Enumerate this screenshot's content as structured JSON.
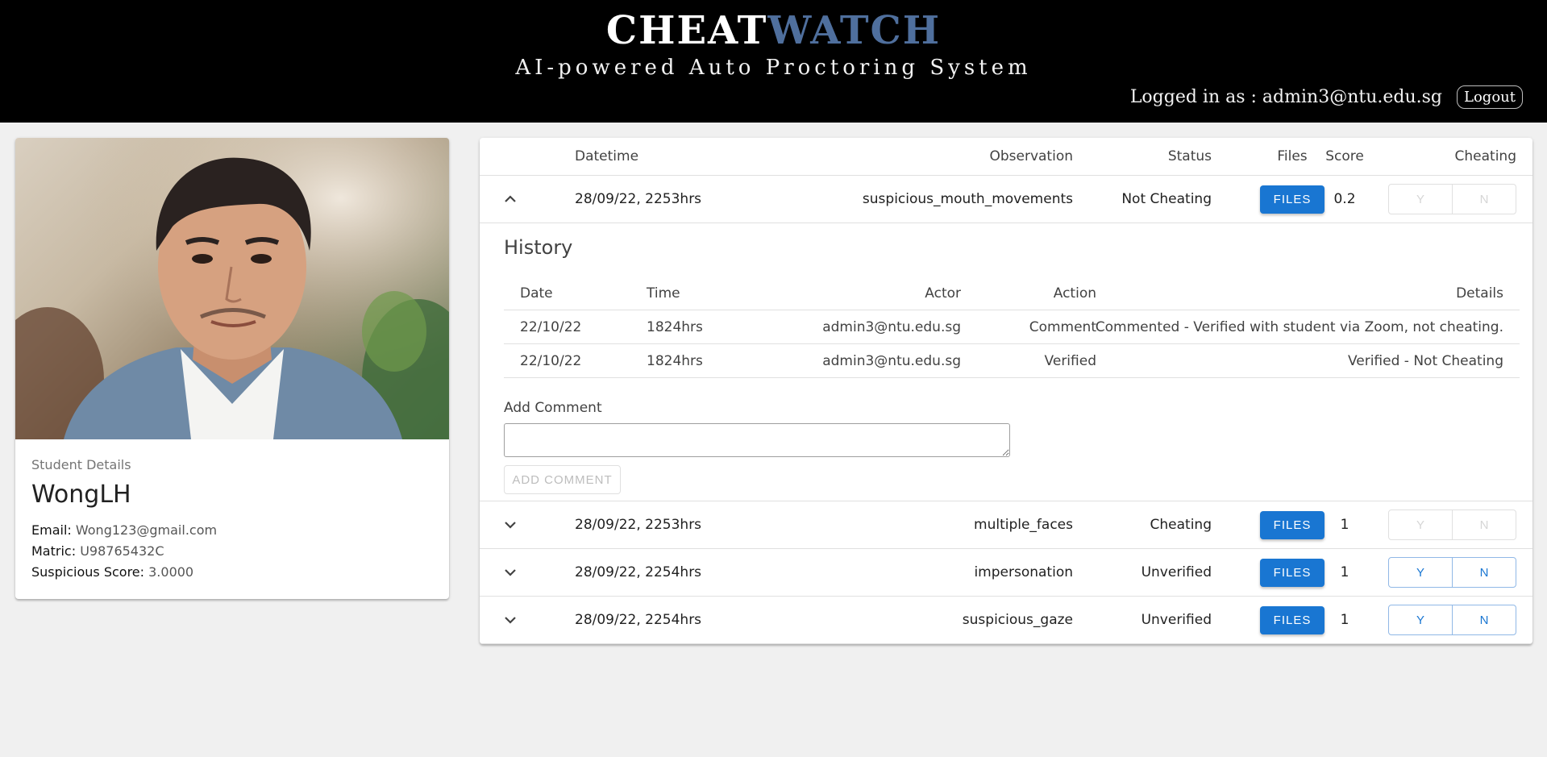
{
  "header": {
    "brand_part1": "CHEAT",
    "brand_part2": "WATCH",
    "tagline": "AI-powered Auto Proctoring System",
    "logged_in_text": "Logged in as : admin3@ntu.edu.sg",
    "logout_label": "Logout"
  },
  "student": {
    "caption": "Student Details",
    "name": "WongLH",
    "email_label": "Email:",
    "email": "Wong123@gmail.com",
    "matric_label": "Matric:",
    "matric": "U98765432C",
    "score_label": "Suspicious Score:",
    "score": "3.0000"
  },
  "table": {
    "headers": {
      "datetime": "Datetime",
      "observation": "Observation",
      "score": "Score",
      "status": "Status",
      "files": "Files",
      "cheating": "Cheating"
    },
    "rows": [
      {
        "datetime": "28/09/22, 2253hrs",
        "observation": "suspicious_mouth_movements",
        "score": "0.2",
        "status": "Not Cheating",
        "files_label": "FILES",
        "yes_label": "Y",
        "no_label": "N",
        "expanded": true,
        "verdict_enabled": false
      },
      {
        "datetime": "28/09/22, 2253hrs",
        "observation": "multiple_faces",
        "score": "1",
        "status": "Cheating",
        "files_label": "FILES",
        "yes_label": "Y",
        "no_label": "N",
        "expanded": false,
        "verdict_enabled": false
      },
      {
        "datetime": "28/09/22, 2254hrs",
        "observation": "impersonation",
        "score": "1",
        "status": "Unverified",
        "files_label": "FILES",
        "yes_label": "Y",
        "no_label": "N",
        "expanded": false,
        "verdict_enabled": true
      },
      {
        "datetime": "28/09/22, 2254hrs",
        "observation": "suspicious_gaze",
        "score": "1",
        "status": "Unverified",
        "files_label": "FILES",
        "yes_label": "Y",
        "no_label": "N",
        "expanded": false,
        "verdict_enabled": true
      }
    ]
  },
  "history": {
    "title": "History",
    "headers": {
      "date": "Date",
      "time": "Time",
      "actor": "Actor",
      "action": "Action",
      "details": "Details"
    },
    "entries": [
      {
        "date": "22/10/22",
        "time": "1824hrs",
        "actor": "admin3@ntu.edu.sg",
        "action": "Comment",
        "details": "Commented - Verified with student via Zoom, not cheating."
      },
      {
        "date": "22/10/22",
        "time": "1824hrs",
        "actor": "admin3@ntu.edu.sg",
        "action": "Verified",
        "details": "Verified - Not Cheating"
      }
    ],
    "add_comment_label": "Add Comment",
    "comment_value": "",
    "add_comment_button": "ADD COMMENT"
  },
  "colors": {
    "header_bg": "#000000",
    "brand_accent": "#4f6f9d",
    "primary": "#1976d2",
    "page_bg": "#f0f0f0"
  },
  "icons": {
    "expanded": "chevron-up-icon",
    "collapsed": "chevron-down-icon"
  }
}
